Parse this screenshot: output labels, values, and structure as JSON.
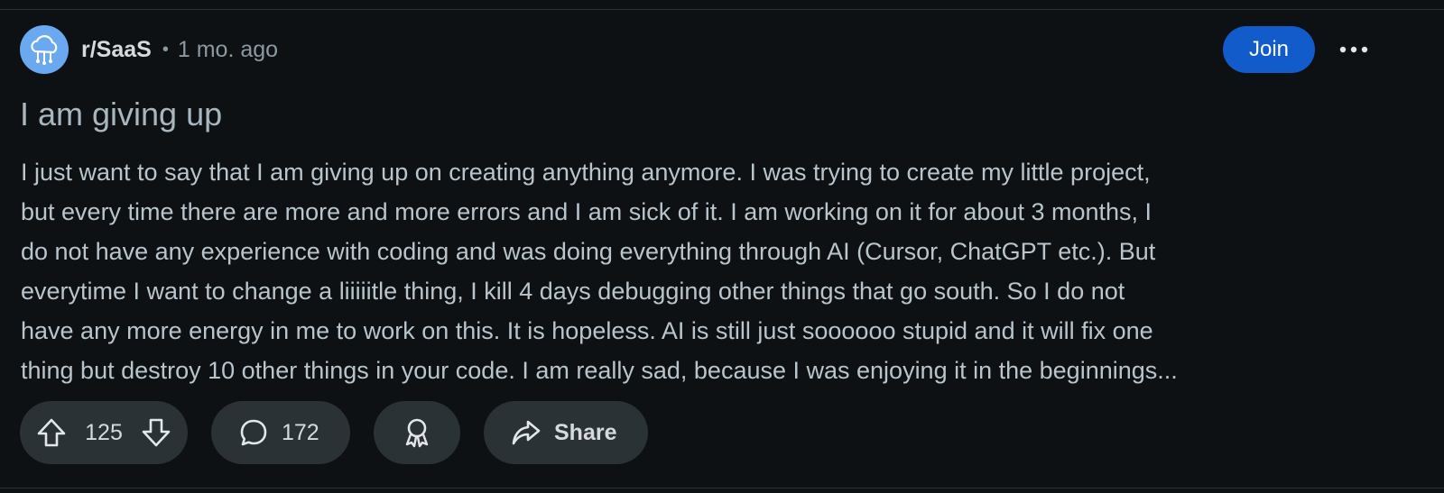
{
  "post": {
    "subreddit": "r/SaaS",
    "separator": "•",
    "time_ago": "1 mo. ago",
    "join_label": "Join",
    "title": "I am giving up",
    "body_lines": [
      "I just want to say that I am giving up on creating anything anymore. I was trying to create my little project,",
      "but every time there are more and more errors and I am sick of it. I am working on it for about 3 months, I",
      "do not have any experience with coding and was doing everything through AI (Cursor, ChatGPT etc.). But",
      "everytime I want to change a liiiiitle thing, I kill 4 days debugging other things that go south. So I do not",
      "have any more energy in me to work on this. It is hopeless. AI is still just soooooo stupid and it will fix one",
      "thing but destroy 10 other things in your code. I am really sad, because I was enjoying it in the beginnings..."
    ]
  },
  "actions": {
    "upvotes": "125",
    "comments": "172",
    "share_label": "Share"
  },
  "icons": {
    "avatar": "cloud-network-icon",
    "more": "more-horizontal-icon",
    "upvote": "upvote-arrow-icon",
    "downvote": "downvote-arrow-icon",
    "comment": "comment-bubble-icon",
    "award": "award-ribbon-icon",
    "share": "share-arrow-icon"
  },
  "colors": {
    "background": "#0e1113",
    "join_button": "#115bca",
    "pill_background": "#2a3236",
    "avatar": "#6aa8f0"
  }
}
